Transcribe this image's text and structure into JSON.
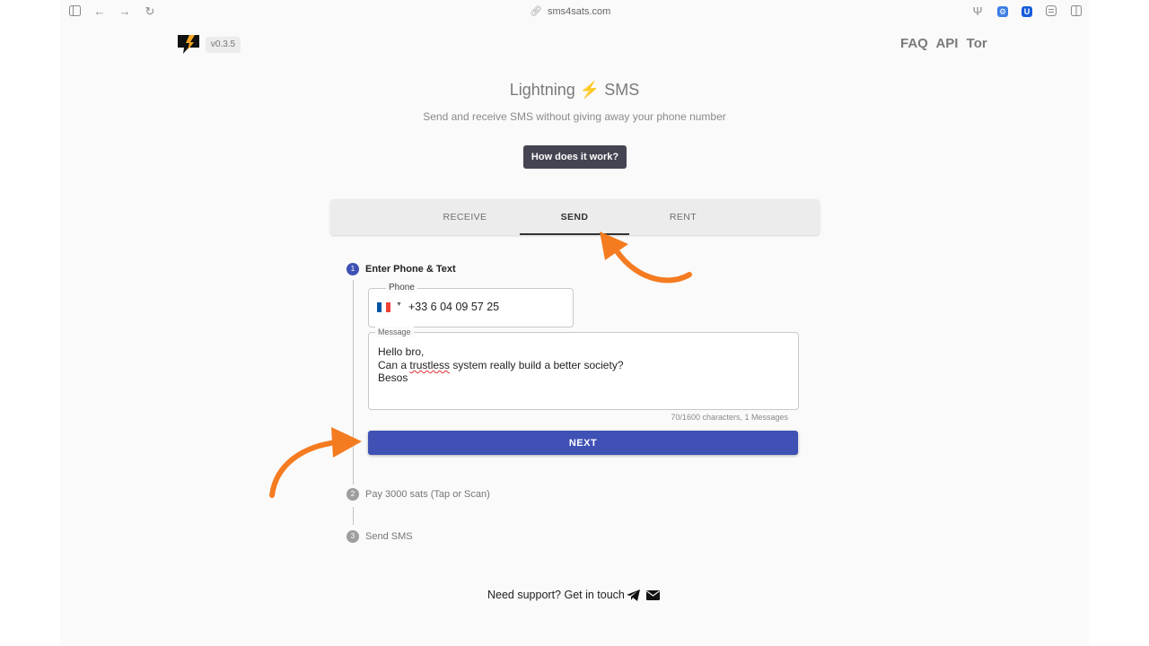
{
  "browser": {
    "url": "sms4sats.com"
  },
  "header": {
    "version": "v0.3.5",
    "nav": [
      "FAQ",
      "API",
      "Tor"
    ]
  },
  "hero": {
    "title_pre": "Lightning",
    "bolt": "⚡",
    "title_post": "SMS",
    "subtitle": "Send and receive SMS without giving away your phone number",
    "how_button": "How does it work?"
  },
  "tabs": [
    {
      "label": "RECEIVE",
      "active": false
    },
    {
      "label": "SEND",
      "active": true
    },
    {
      "label": "RENT",
      "active": false
    }
  ],
  "steps": [
    {
      "number": "1",
      "label": "Enter Phone & Text",
      "active": true
    },
    {
      "number": "2",
      "label": "Pay 3000 sats (Tap or Scan)",
      "active": false
    },
    {
      "number": "3",
      "label": "Send SMS",
      "active": false
    }
  ],
  "phone": {
    "label": "Phone",
    "value": "+33 6 04 09 57 25"
  },
  "message": {
    "label": "Message",
    "lines": [
      "Hello bro,",
      "Can a",
      "trustless",
      "system really build a better society?",
      "Besos"
    ],
    "counter": "70/1600 characters, 1 Messages"
  },
  "next_button": "NEXT",
  "support": {
    "text": "Need support? Get in touch"
  },
  "colors": {
    "primary": "#3f51b5",
    "annotation_arrow": "#f47b20",
    "dark_button": "#444452"
  }
}
